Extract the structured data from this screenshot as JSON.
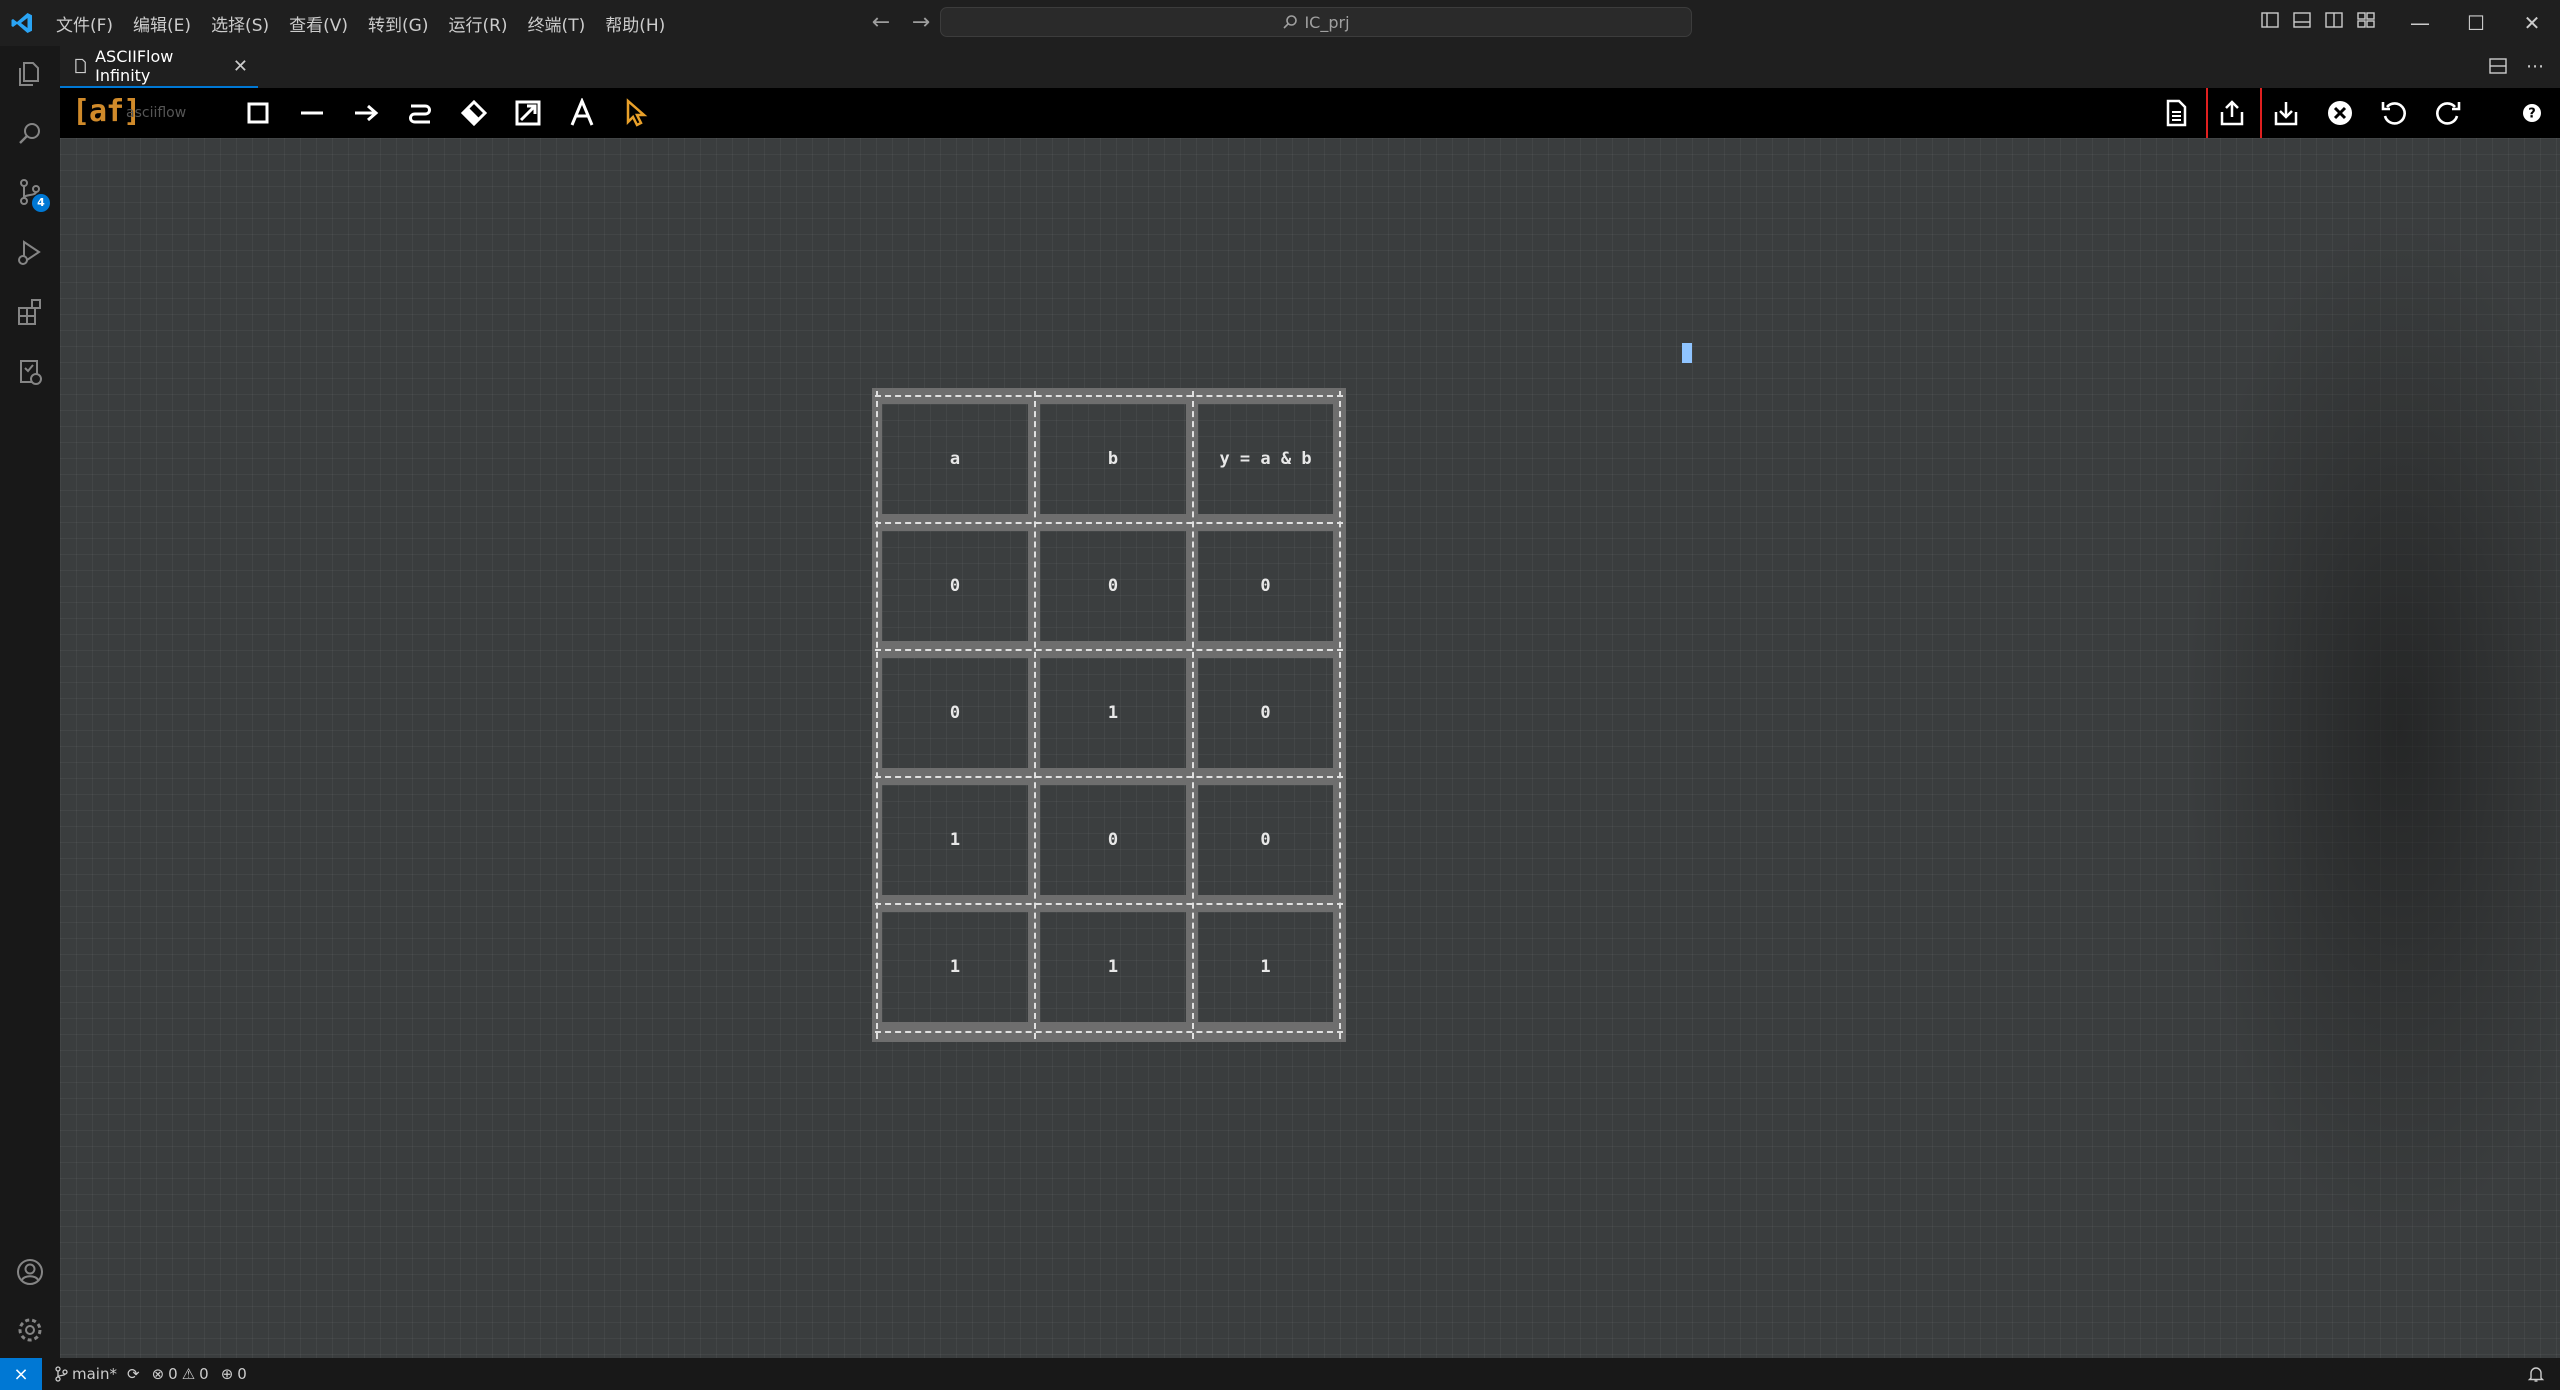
{
  "titlebar": {
    "menus": [
      "文件(F)",
      "编辑(E)",
      "选择(S)",
      "查看(V)",
      "转到(G)",
      "运行(R)",
      "终端(T)",
      "帮助(H)"
    ],
    "search_text": "IC_prj"
  },
  "activitybar": {
    "source_control_badge": "4"
  },
  "tabs": [
    {
      "label": "ASCIIFlow Infinity"
    }
  ],
  "asciiflow": {
    "logo": "[af]",
    "name": "asciiflow",
    "table": {
      "header": [
        "a",
        "b",
        "y = a & b"
      ],
      "rows": [
        [
          "0",
          "0",
          "0"
        ],
        [
          "0",
          "1",
          "0"
        ],
        [
          "1",
          "0",
          "0"
        ],
        [
          "1",
          "1",
          "1"
        ]
      ]
    }
  },
  "statusbar": {
    "branch": "main*",
    "errors": "0",
    "warnings": "0",
    "ports": "0"
  },
  "colors": {
    "accent": "#0078d4",
    "logo": "#d08a2a",
    "select_tool": "#e8a02a",
    "highlight": "#e02020"
  }
}
